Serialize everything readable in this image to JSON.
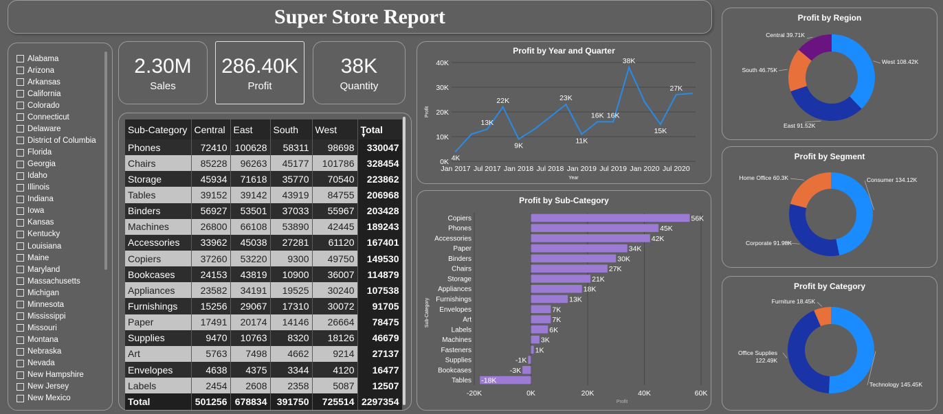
{
  "report_title": "Super Store Report",
  "slicer": {
    "states": [
      "Alabama",
      "Arizona",
      "Arkansas",
      "California",
      "Colorado",
      "Connecticut",
      "Delaware",
      "District of Columbia",
      "Florida",
      "Georgia",
      "Idaho",
      "Illinois",
      "Indiana",
      "Iowa",
      "Kansas",
      "Kentucky",
      "Louisiana",
      "Maine",
      "Maryland",
      "Massachusetts",
      "Michigan",
      "Minnesota",
      "Mississippi",
      "Missouri",
      "Montana",
      "Nebraska",
      "Nevada",
      "New Hampshire",
      "New Jersey",
      "New Mexico"
    ]
  },
  "kpis": [
    {
      "value": "2.30M",
      "label": "Sales"
    },
    {
      "value": "286.40K",
      "label": "Profit"
    },
    {
      "value": "38K",
      "label": "Quantity"
    }
  ],
  "matrix": {
    "headers": [
      "Sub-Category",
      "Central",
      "East",
      "South",
      "West",
      "Total"
    ],
    "rows": [
      [
        "Phones",
        "72410",
        "100628",
        "58311",
        "98698",
        "330047"
      ],
      [
        "Chairs",
        "85228",
        "96263",
        "45177",
        "101786",
        "328454"
      ],
      [
        "Storage",
        "45934",
        "71618",
        "35770",
        "70540",
        "223862"
      ],
      [
        "Tables",
        "39152",
        "39142",
        "43919",
        "84755",
        "206968"
      ],
      [
        "Binders",
        "56927",
        "53501",
        "37033",
        "55967",
        "203428"
      ],
      [
        "Machines",
        "26800",
        "66108",
        "53890",
        "42445",
        "189243"
      ],
      [
        "Accessories",
        "33962",
        "45038",
        "27281",
        "61120",
        "167401"
      ],
      [
        "Copiers",
        "37260",
        "53220",
        "9300",
        "49750",
        "149530"
      ],
      [
        "Bookcases",
        "24153",
        "43819",
        "10900",
        "36007",
        "114879"
      ],
      [
        "Appliances",
        "23582",
        "34191",
        "19525",
        "30240",
        "107538"
      ],
      [
        "Furnishings",
        "15256",
        "29067",
        "17310",
        "30072",
        "91705"
      ],
      [
        "Paper",
        "17491",
        "20174",
        "14146",
        "26664",
        "78475"
      ],
      [
        "Supplies",
        "9470",
        "10763",
        "8320",
        "18126",
        "46679"
      ],
      [
        "Art",
        "5763",
        "7498",
        "4662",
        "9214",
        "27137"
      ],
      [
        "Envelopes",
        "4638",
        "4375",
        "3344",
        "4120",
        "16477"
      ],
      [
        "Labels",
        "2454",
        "2608",
        "2358",
        "5087",
        "12507"
      ]
    ],
    "total_row": [
      "Total",
      "501256",
      "678834",
      "391750",
      "725514",
      "2297354"
    ]
  },
  "chart_data": [
    {
      "type": "line",
      "title": "Profit by Year and Quarter",
      "xlabel": "Year",
      "ylabel": "Profit",
      "x": [
        "2017 Q1",
        "2017 Q2",
        "2017 Q3",
        "2017 Q4",
        "2018 Q1",
        "2018 Q2",
        "2018 Q3",
        "2018 Q4",
        "2019 Q1",
        "2019 Q2",
        "2019 Q3",
        "2019 Q4",
        "2020 Q1",
        "2020 Q2",
        "2020 Q3",
        "2020 Q4"
      ],
      "values": [
        4000,
        11000,
        13000,
        22000,
        9000,
        13000,
        18000,
        23000,
        11000,
        16000,
        16000,
        38000,
        24000,
        15000,
        27000,
        27500
      ],
      "data_labels": [
        "4K",
        "",
        "13K",
        "22K",
        "9K",
        "",
        "",
        "23K",
        "11K",
        "16K",
        "16K",
        "38K",
        "",
        "15K",
        "27K",
        ""
      ],
      "x_ticks": [
        "Jan 2017",
        "Jul 2017",
        "Jan 2018",
        "Jul 2018",
        "Jan 2019",
        "Jul 2019",
        "Jan 2020",
        "Jul 2020"
      ],
      "y_ticks": [
        "0K",
        "10K",
        "20K",
        "30K",
        "40K"
      ],
      "ylim": [
        0,
        40000
      ],
      "color": "#2b8ae6"
    },
    {
      "type": "bar",
      "orientation": "horizontal",
      "title": "Profit by Sub-Category",
      "xlabel": "Profit",
      "ylabel": "Sub-Category",
      "categories": [
        "Copiers",
        "Phones",
        "Accessories",
        "Paper",
        "Binders",
        "Chairs",
        "Storage",
        "Appliances",
        "Furnishings",
        "Envelopes",
        "Art",
        "Labels",
        "Machines",
        "Fasteners",
        "Supplies",
        "Bookcases",
        "Tables"
      ],
      "values": [
        56000,
        45000,
        42000,
        34000,
        30000,
        27000,
        21000,
        18000,
        13000,
        7000,
        7000,
        6000,
        3000,
        1000,
        -1000,
        -3000,
        -18000
      ],
      "data_labels": [
        "56K",
        "45K",
        "42K",
        "34K",
        "30K",
        "27K",
        "21K",
        "18K",
        "13K",
        "7K",
        "7K",
        "6K",
        "3K",
        "1K",
        "-1K",
        "-3K",
        "-18K"
      ],
      "x_ticks": [
        "-20K",
        "0K",
        "20K",
        "40K",
        "60K"
      ],
      "xlim": [
        -20000,
        60000
      ],
      "color": "#9b7bd4"
    },
    {
      "type": "pie",
      "title": "Profit by Region",
      "slices": [
        {
          "label": "West 108.42K",
          "value": 108.42,
          "color": "#1a8cff"
        },
        {
          "label": "East 91.52K",
          "value": 91.52,
          "color": "#1a33a6"
        },
        {
          "label": "South 46.75K",
          "value": 46.75,
          "color": "#e8703a"
        },
        {
          "label": "Central 39.71K",
          "value": 39.71,
          "color": "#6b1380"
        }
      ]
    },
    {
      "type": "pie",
      "title": "Profit by Segment",
      "slices": [
        {
          "label": "Consumer 134.12K",
          "value": 134.12,
          "color": "#1a8cff"
        },
        {
          "label": "Corporate 91.98K",
          "value": 91.98,
          "color": "#1a33a6"
        },
        {
          "label": "Home Office 60.3K",
          "value": 60.3,
          "color": "#e8703a"
        }
      ]
    },
    {
      "type": "pie",
      "title": "Profit by Category",
      "slices": [
        {
          "label": "Technology 145.45K",
          "value": 145.45,
          "color": "#1a8cff"
        },
        {
          "label": "Office Supplies 122.49K",
          "value": 122.49,
          "color": "#1a33a6"
        },
        {
          "label": "Furniture 18.45K",
          "value": 18.45,
          "color": "#e8703a"
        }
      ]
    }
  ]
}
